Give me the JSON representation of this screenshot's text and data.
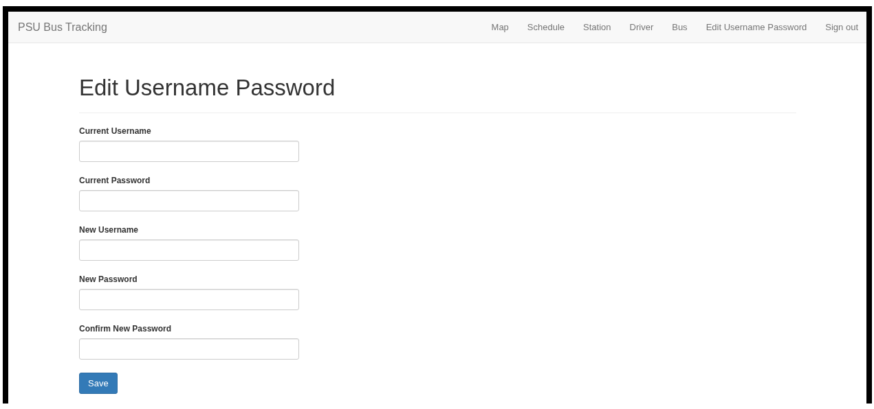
{
  "navbar": {
    "brand": "PSU Bus Tracking",
    "links": [
      {
        "label": "Map"
      },
      {
        "label": "Schedule"
      },
      {
        "label": "Station"
      },
      {
        "label": "Driver"
      },
      {
        "label": "Bus"
      },
      {
        "label": "Edit Username Password"
      },
      {
        "label": "Sign out"
      }
    ]
  },
  "page": {
    "heading": "Edit Username Password"
  },
  "form": {
    "fields": [
      {
        "label": "Current Username"
      },
      {
        "label": "Current Password"
      },
      {
        "label": "New Username"
      },
      {
        "label": "New Password"
      },
      {
        "label": "Confirm New Password"
      }
    ],
    "submit": "Save"
  }
}
